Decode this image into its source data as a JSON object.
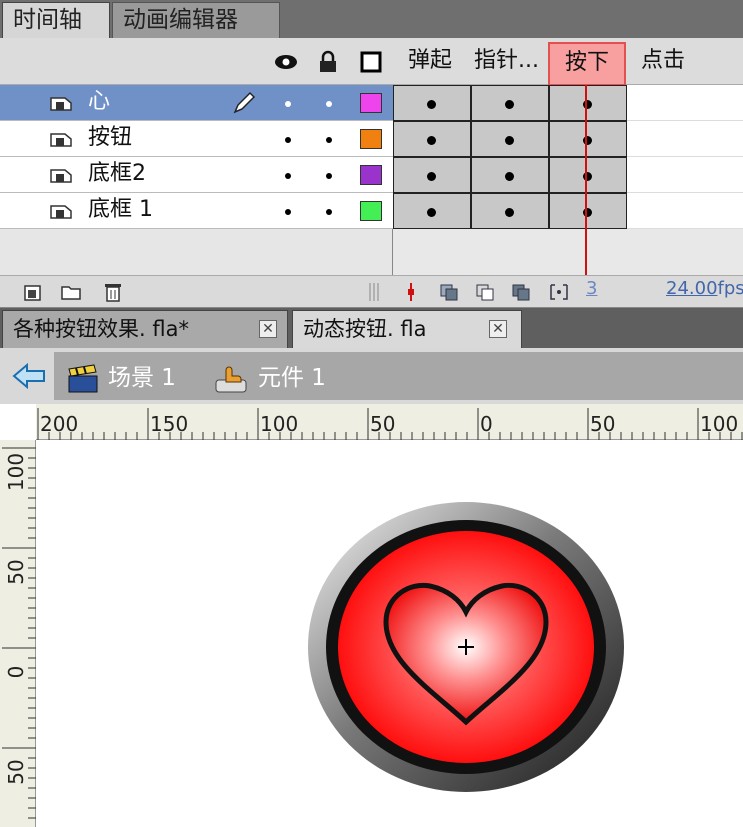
{
  "panel_tabs": {
    "timeline": "时间轴",
    "motion_editor": "动画编辑器"
  },
  "frame_labels": {
    "up": "弹起",
    "over": "指针...",
    "down": "按下",
    "hit": "点击"
  },
  "layers": [
    {
      "name": "心",
      "outline_color": "#ee44ee",
      "selected": true
    },
    {
      "name": "按钮",
      "outline_color": "#f08010",
      "selected": false
    },
    {
      "name": "底框2",
      "outline_color": "#9933cc",
      "selected": false
    },
    {
      "name": "底框 1",
      "outline_color": "#44ee55",
      "selected": false
    }
  ],
  "timeline_status": {
    "current_frame": "3",
    "fps_value": "24.00",
    "fps_unit": "fps"
  },
  "document_tabs": [
    {
      "label": "各种按钮效果. fla*",
      "active": false
    },
    {
      "label": "动态按钮. fla",
      "active": true
    }
  ],
  "breadcrumb": {
    "scene": "场景 1",
    "symbol": "元件 1"
  },
  "ruler": {
    "top_labels": [
      "200",
      "150",
      "100",
      "50",
      "0",
      "50",
      "100"
    ],
    "left_labels": [
      "100",
      "50",
      "0",
      "50"
    ]
  },
  "colors": {
    "selected_layer": "#7090c8",
    "current_frame_highlight": "#f8a0a0",
    "playhead": "#d01010",
    "button_red": "#ff1010"
  }
}
